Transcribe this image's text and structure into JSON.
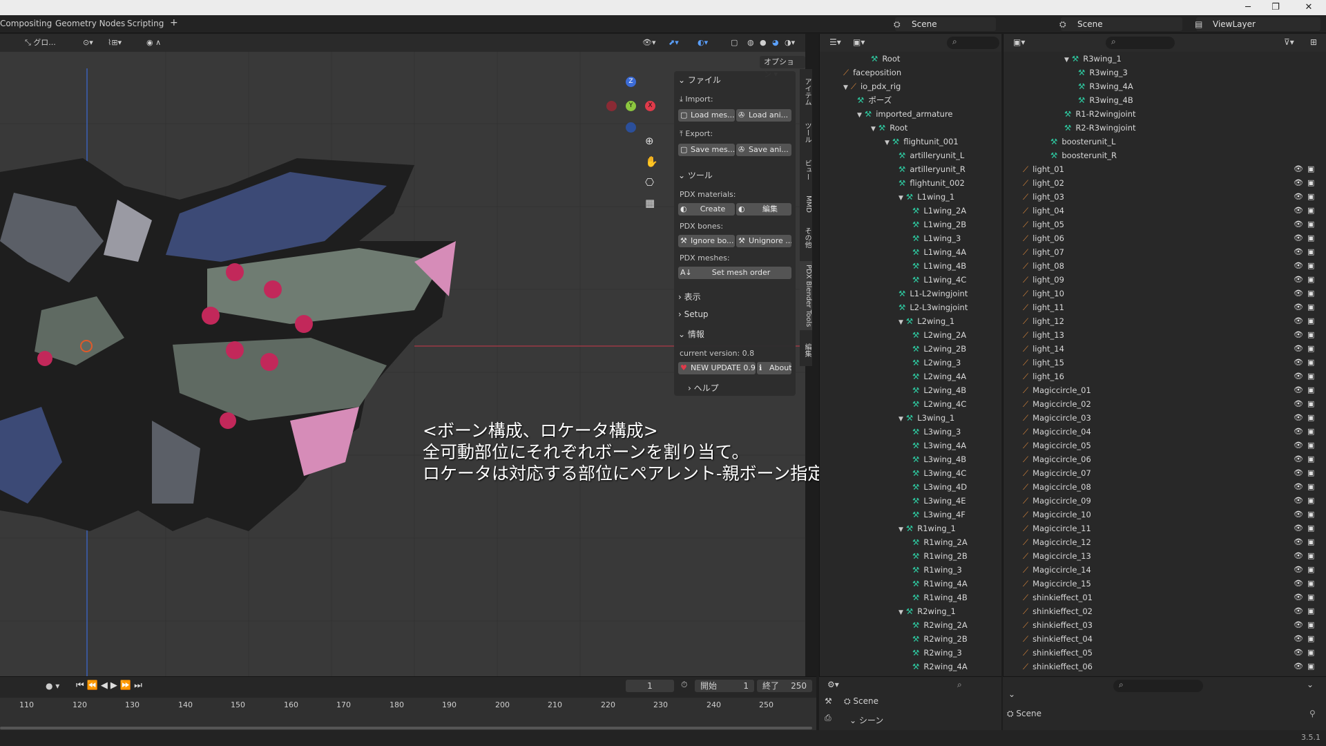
{
  "window": {
    "minimize": "─",
    "restore": "❐",
    "close": "✕"
  },
  "topbar": {
    "tabs": [
      "Compositing",
      "Geometry Nodes",
      "Scripting"
    ],
    "add_tab": "+",
    "scene1": "Scene",
    "scene2": "Scene",
    "viewlayer": "ViewLayer"
  },
  "viewport": {
    "orientation": "グロ...",
    "options": "オプション",
    "gizmo": {
      "z": "Z",
      "y": "Y",
      "x": "X"
    }
  },
  "npanel": {
    "file_section": "ファイル",
    "import_label": "Import:",
    "load_mesh": "Load mes...",
    "load_anim": "Load ani...",
    "export_label": "Export:",
    "save_mesh": "Save mes...",
    "save_anim": "Save ani...",
    "tool_section": "ツール",
    "pdx_materials": "PDX materials:",
    "create": "Create",
    "edit": "編集",
    "pdx_bones": "PDX bones:",
    "ignore_bones": "Ignore bo...",
    "unignore": "Unignore ...",
    "pdx_meshes": "PDX meshes:",
    "set_mesh_order": "Set mesh order",
    "display_section": "表示",
    "setup_section": "Setup",
    "info_section": "情報",
    "current_version": "current version: 0.8",
    "new_update": "NEW UPDATE 0.9",
    "about": "About",
    "help": "ヘルプ"
  },
  "vtabs": [
    "アイテム",
    "ツール",
    "ビュー",
    "MMD",
    "その他",
    "PDX Blender Tools",
    "編集"
  ],
  "caption": {
    "line1": "<ボーン構成、ロケータ構成>",
    "line2": "全可動部位にそれぞれボーンを割り当て。",
    "line3": "ロケータは対応する部位にペアレント-親ボーン指定。"
  },
  "timeline": {
    "frame": "1",
    "start_label": "開始",
    "start": "1",
    "end_label": "終了",
    "end": "250",
    "ticks": [
      "110",
      "120",
      "130",
      "140",
      "150",
      "160",
      "170",
      "180",
      "190",
      "200",
      "210",
      "220",
      "230",
      "240",
      "250"
    ]
  },
  "outliner1": {
    "rows": [
      {
        "label": "Root",
        "indent": 3,
        "kind": "bone",
        "arrow": ""
      },
      {
        "label": "faceposition",
        "indent": 1,
        "kind": "obj",
        "arrow": ""
      },
      {
        "label": "io_pdx_rig",
        "indent": 1,
        "kind": "obj",
        "arrow": "▼"
      },
      {
        "label": "ポーズ",
        "indent": 2,
        "kind": "bone",
        "arrow": ""
      },
      {
        "label": "imported_armature",
        "indent": 2,
        "kind": "bone",
        "arrow": "▼"
      },
      {
        "label": "Root",
        "indent": 3,
        "kind": "bone",
        "arrow": "▼"
      },
      {
        "label": "flightunit_001",
        "indent": 4,
        "kind": "bone",
        "arrow": "▼"
      },
      {
        "label": "artilleryunit_L",
        "indent": 5,
        "kind": "bone",
        "arrow": ""
      },
      {
        "label": "artilleryunit_R",
        "indent": 5,
        "kind": "bone",
        "arrow": ""
      },
      {
        "label": "flightunit_002",
        "indent": 5,
        "kind": "bone",
        "arrow": ""
      },
      {
        "label": "L1wing_1",
        "indent": 5,
        "kind": "bone",
        "arrow": "▼"
      },
      {
        "label": "L1wing_2A",
        "indent": 6,
        "kind": "bone",
        "arrow": ""
      },
      {
        "label": "L1wing_2B",
        "indent": 6,
        "kind": "bone",
        "arrow": ""
      },
      {
        "label": "L1wing_3",
        "indent": 6,
        "kind": "bone",
        "arrow": ""
      },
      {
        "label": "L1wing_4A",
        "indent": 6,
        "kind": "bone",
        "arrow": ""
      },
      {
        "label": "L1wing_4B",
        "indent": 6,
        "kind": "bone",
        "arrow": ""
      },
      {
        "label": "L1wing_4C",
        "indent": 6,
        "kind": "bone",
        "arrow": ""
      },
      {
        "label": "L1-L2wingjoint",
        "indent": 5,
        "kind": "bone",
        "arrow": ""
      },
      {
        "label": "L2-L3wingjoint",
        "indent": 5,
        "kind": "bone",
        "arrow": ""
      },
      {
        "label": "L2wing_1",
        "indent": 5,
        "kind": "bone",
        "arrow": "▼"
      },
      {
        "label": "L2wing_2A",
        "indent": 6,
        "kind": "bone",
        "arrow": ""
      },
      {
        "label": "L2wing_2B",
        "indent": 6,
        "kind": "bone",
        "arrow": ""
      },
      {
        "label": "L2wing_3",
        "indent": 6,
        "kind": "bone",
        "arrow": ""
      },
      {
        "label": "L2wing_4A",
        "indent": 6,
        "kind": "bone",
        "arrow": ""
      },
      {
        "label": "L2wing_4B",
        "indent": 6,
        "kind": "bone",
        "arrow": ""
      },
      {
        "label": "L2wing_4C",
        "indent": 6,
        "kind": "bone",
        "arrow": ""
      },
      {
        "label": "L3wing_1",
        "indent": 5,
        "kind": "bone",
        "arrow": "▼"
      },
      {
        "label": "L3wing_3",
        "indent": 6,
        "kind": "bone",
        "arrow": ""
      },
      {
        "label": "L3wing_4A",
        "indent": 6,
        "kind": "bone",
        "arrow": ""
      },
      {
        "label": "L3wing_4B",
        "indent": 6,
        "kind": "bone",
        "arrow": ""
      },
      {
        "label": "L3wing_4C",
        "indent": 6,
        "kind": "bone",
        "arrow": ""
      },
      {
        "label": "L3wing_4D",
        "indent": 6,
        "kind": "bone",
        "arrow": ""
      },
      {
        "label": "L3wing_4E",
        "indent": 6,
        "kind": "bone",
        "arrow": ""
      },
      {
        "label": "L3wing_4F",
        "indent": 6,
        "kind": "bone",
        "arrow": ""
      },
      {
        "label": "R1wing_1",
        "indent": 5,
        "kind": "bone",
        "arrow": "▼"
      },
      {
        "label": "R1wing_2A",
        "indent": 6,
        "kind": "bone",
        "arrow": ""
      },
      {
        "label": "R1wing_2B",
        "indent": 6,
        "kind": "bone",
        "arrow": ""
      },
      {
        "label": "R1wing_3",
        "indent": 6,
        "kind": "bone",
        "arrow": ""
      },
      {
        "label": "R1wing_4A",
        "indent": 6,
        "kind": "bone",
        "arrow": ""
      },
      {
        "label": "R1wing_4B",
        "indent": 6,
        "kind": "bone",
        "arrow": ""
      },
      {
        "label": "R2wing_1",
        "indent": 5,
        "kind": "bone",
        "arrow": "▼"
      },
      {
        "label": "R2wing_2A",
        "indent": 6,
        "kind": "bone",
        "arrow": ""
      },
      {
        "label": "R2wing_2B",
        "indent": 6,
        "kind": "bone",
        "arrow": ""
      },
      {
        "label": "R2wing_3",
        "indent": 6,
        "kind": "bone",
        "arrow": ""
      },
      {
        "label": "R2wing_4A",
        "indent": 6,
        "kind": "bone",
        "arrow": ""
      }
    ]
  },
  "outliner2": {
    "rows": [
      {
        "label": "R3wing_1",
        "indent": 3,
        "kind": "bone",
        "arrow": "▼",
        "eye": false
      },
      {
        "label": "R3wing_3",
        "indent": 4,
        "kind": "bone",
        "arrow": "",
        "eye": false
      },
      {
        "label": "R3wing_4A",
        "indent": 4,
        "kind": "bone",
        "arrow": "",
        "eye": false
      },
      {
        "label": "R3wing_4B",
        "indent": 4,
        "kind": "bone",
        "arrow": "",
        "eye": false
      },
      {
        "label": "R1-R2wingjoint",
        "indent": 3,
        "kind": "bone",
        "arrow": "",
        "eye": false
      },
      {
        "label": "R2-R3wingjoint",
        "indent": 3,
        "kind": "bone",
        "arrow": "",
        "eye": false
      },
      {
        "label": "boosterunit_L",
        "indent": 2,
        "kind": "bone",
        "arrow": "",
        "eye": false
      },
      {
        "label": "boosterunit_R",
        "indent": 2,
        "kind": "bone",
        "arrow": "",
        "eye": false
      },
      {
        "label": "light_01",
        "indent": 0,
        "kind": "obj",
        "arrow": "",
        "eye": true
      },
      {
        "label": "light_02",
        "indent": 0,
        "kind": "obj",
        "arrow": "",
        "eye": true
      },
      {
        "label": "light_03",
        "indent": 0,
        "kind": "obj",
        "arrow": "",
        "eye": true
      },
      {
        "label": "light_04",
        "indent": 0,
        "kind": "obj",
        "arrow": "",
        "eye": true
      },
      {
        "label": "light_05",
        "indent": 0,
        "kind": "obj",
        "arrow": "",
        "eye": true
      },
      {
        "label": "light_06",
        "indent": 0,
        "kind": "obj",
        "arrow": "",
        "eye": true
      },
      {
        "label": "light_07",
        "indent": 0,
        "kind": "obj",
        "arrow": "",
        "eye": true
      },
      {
        "label": "light_08",
        "indent": 0,
        "kind": "obj",
        "arrow": "",
        "eye": true
      },
      {
        "label": "light_09",
        "indent": 0,
        "kind": "obj",
        "arrow": "",
        "eye": true
      },
      {
        "label": "light_10",
        "indent": 0,
        "kind": "obj",
        "arrow": "",
        "eye": true
      },
      {
        "label": "light_11",
        "indent": 0,
        "kind": "obj",
        "arrow": "",
        "eye": true
      },
      {
        "label": "light_12",
        "indent": 0,
        "kind": "obj",
        "arrow": "",
        "eye": true
      },
      {
        "label": "light_13",
        "indent": 0,
        "kind": "obj",
        "arrow": "",
        "eye": true
      },
      {
        "label": "light_14",
        "indent": 0,
        "kind": "obj",
        "arrow": "",
        "eye": true
      },
      {
        "label": "light_15",
        "indent": 0,
        "kind": "obj",
        "arrow": "",
        "eye": true
      },
      {
        "label": "light_16",
        "indent": 0,
        "kind": "obj",
        "arrow": "",
        "eye": true
      },
      {
        "label": "Magiccircle_01",
        "indent": 0,
        "kind": "obj",
        "arrow": "",
        "eye": true
      },
      {
        "label": "Magiccircle_02",
        "indent": 0,
        "kind": "obj",
        "arrow": "",
        "eye": true
      },
      {
        "label": "Magiccircle_03",
        "indent": 0,
        "kind": "obj",
        "arrow": "",
        "eye": true
      },
      {
        "label": "Magiccircle_04",
        "indent": 0,
        "kind": "obj",
        "arrow": "",
        "eye": true
      },
      {
        "label": "Magiccircle_05",
        "indent": 0,
        "kind": "obj",
        "arrow": "",
        "eye": true
      },
      {
        "label": "Magiccircle_06",
        "indent": 0,
        "kind": "obj",
        "arrow": "",
        "eye": true
      },
      {
        "label": "Magiccircle_07",
        "indent": 0,
        "kind": "obj",
        "arrow": "",
        "eye": true
      },
      {
        "label": "Magiccircle_08",
        "indent": 0,
        "kind": "obj",
        "arrow": "",
        "eye": true
      },
      {
        "label": "Magiccircle_09",
        "indent": 0,
        "kind": "obj",
        "arrow": "",
        "eye": true
      },
      {
        "label": "Magiccircle_10",
        "indent": 0,
        "kind": "obj",
        "arrow": "",
        "eye": true
      },
      {
        "label": "Magiccircle_11",
        "indent": 0,
        "kind": "obj",
        "arrow": "",
        "eye": true
      },
      {
        "label": "Magiccircle_12",
        "indent": 0,
        "kind": "obj",
        "arrow": "",
        "eye": true
      },
      {
        "label": "Magiccircle_13",
        "indent": 0,
        "kind": "obj",
        "arrow": "",
        "eye": true
      },
      {
        "label": "Magiccircle_14",
        "indent": 0,
        "kind": "obj",
        "arrow": "",
        "eye": true
      },
      {
        "label": "Magiccircle_15",
        "indent": 0,
        "kind": "obj",
        "arrow": "",
        "eye": true
      },
      {
        "label": "shinkieffect_01",
        "indent": 0,
        "kind": "obj",
        "arrow": "",
        "eye": true
      },
      {
        "label": "shinkieffect_02",
        "indent": 0,
        "kind": "obj",
        "arrow": "",
        "eye": true
      },
      {
        "label": "shinkieffect_03",
        "indent": 0,
        "kind": "obj",
        "arrow": "",
        "eye": true
      },
      {
        "label": "shinkieffect_04",
        "indent": 0,
        "kind": "obj",
        "arrow": "",
        "eye": true
      },
      {
        "label": "shinkieffect_05",
        "indent": 0,
        "kind": "obj",
        "arrow": "",
        "eye": true
      },
      {
        "label": "shinkieffect_06",
        "indent": 0,
        "kind": "obj",
        "arrow": "",
        "eye": true
      }
    ]
  },
  "props1": {
    "scene": "Scene",
    "section": "シーン"
  },
  "props2": {
    "scene": "Scene"
  },
  "status": {
    "version": "3.5.1"
  },
  "colors": {
    "bone": "#2ec9a0",
    "object": "#e08a3c",
    "accent_red": "#e03a4a"
  }
}
